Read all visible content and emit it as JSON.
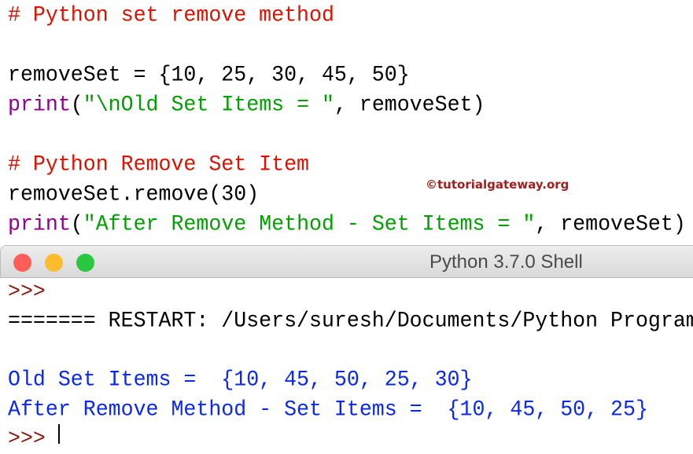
{
  "editor": {
    "lines": [
      {
        "comment": "# Python set remove method"
      },
      {
        "code": "removeSet = {10, 25, 30, 45, 50}"
      },
      {
        "kw": "print",
        "open": "(",
        "str": "\"\\nOld Set Items = \"",
        "rest": ", removeSet)"
      },
      {
        "comment": "# Python Remove Set Item"
      },
      {
        "code": "removeSet.remove(30)"
      },
      {
        "kw": "print",
        "open": "(",
        "str": "\"After Remove Method - Set Items = \"",
        "rest": ", removeSet)"
      }
    ],
    "watermark": "©tutorialgateway.org"
  },
  "shell": {
    "title": "Python 3.7.0 Shell",
    "prompt": ">>>",
    "restart": "======= RESTART: /Users/suresh/Documents/Python Programs",
    "output1": "Old Set Items =  {10, 45, 50, 25, 30}",
    "output2": "After Remove Method - Set Items =  {10, 45, 50, 25}",
    "colors": {
      "close": "#fc5f57",
      "minimize": "#fdbc2e",
      "zoom": "#28c840"
    }
  }
}
